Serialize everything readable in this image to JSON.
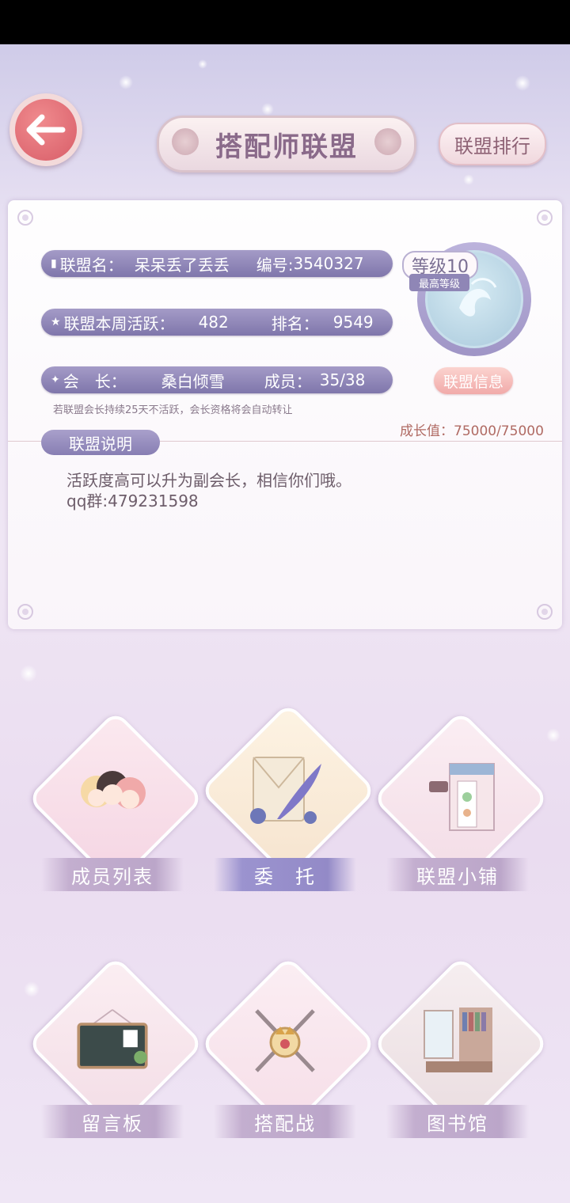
{
  "header": {
    "title": "搭配师联盟",
    "rank_button": "联盟排行"
  },
  "alliance": {
    "name_label": "联盟名：",
    "name_value": "呆呆丢了丢丢",
    "id_label": "编号:",
    "id_value": "3540327",
    "weekly_label": "联盟本周活跃：",
    "weekly_value": "482",
    "rank_label": "排名：",
    "rank_value": "9549",
    "leader_label": "会　长：",
    "leader_value": "桑白倾雪",
    "members_label": "成员：",
    "members_value": "35/38",
    "level_label": "等级10",
    "level_sub": "最高等级",
    "info_button": "联盟信息",
    "note": "若联盟会长持续25天不活跃，会长资格将会自动转让",
    "growth": "成长值：75000/75000"
  },
  "description": {
    "tag": "联盟说明",
    "line1": "活跃度高可以升为副会长，相信你们哦。",
    "line2": "qq群:479231598"
  },
  "menu": [
    {
      "label": "成员列表",
      "icon": "members-illustration"
    },
    {
      "label": "委　托",
      "icon": "envelope-quill-illustration"
    },
    {
      "label": "联盟小铺",
      "icon": "shop-illustration"
    },
    {
      "label": "留言板",
      "icon": "chalkboard-illustration"
    },
    {
      "label": "搭配战",
      "icon": "crossed-swords-crest-illustration"
    },
    {
      "label": "图书馆",
      "icon": "library-illustration"
    }
  ],
  "colors": {
    "accent_purple": "#8f86b6",
    "back_button": "#d85d68",
    "growth_text": "#b06a63"
  }
}
